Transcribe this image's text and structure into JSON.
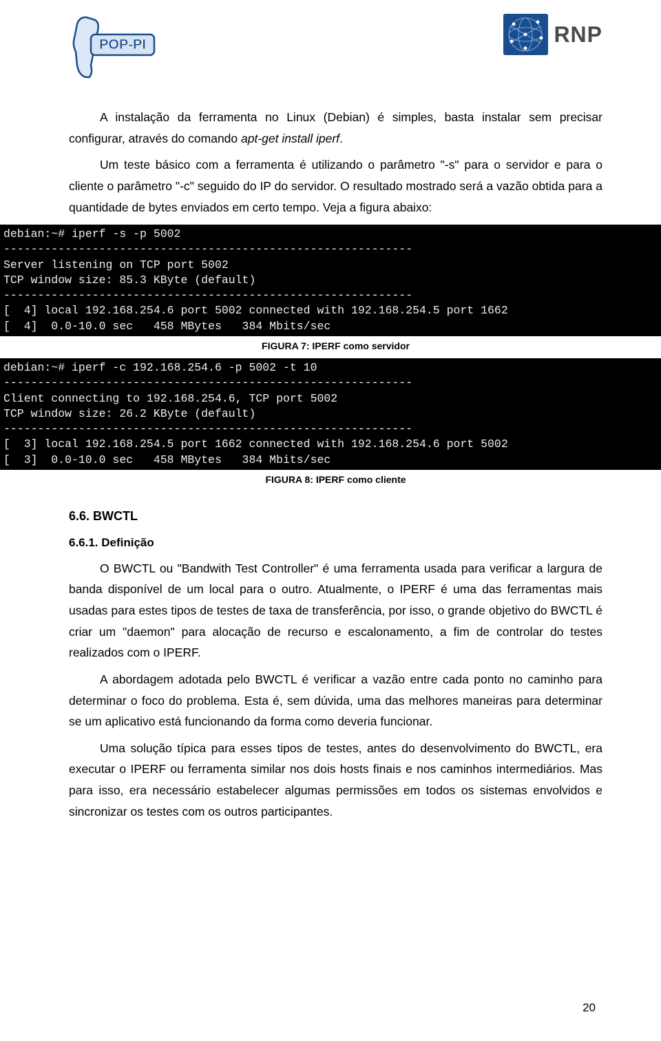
{
  "header": {
    "logo_left_label": "POP-PI",
    "logo_right_label": "RNP"
  },
  "para1_a": "A instalação da ferramenta no Linux (Debian) é simples, basta instalar sem precisar configurar, através do comando ",
  "para1_b": "apt-get install iperf",
  "para1_c": ".",
  "para2_a": "Um teste básico com a ferramenta é utilizando o parâmetro \"-s\" para o servidor e para o cliente o parâmetro \"-c\" seguido do IP do servidor. O resultado mostrado será a vazão obtida para a quantidade de bytes enviados em certo tempo. Veja a figura abaixo:",
  "terminal1": "debian:~# iperf -s -p 5002\n------------------------------------------------------------\nServer listening on TCP port 5002\nTCP window size: 85.3 KByte (default)\n------------------------------------------------------------\n[  4] local 192.168.254.6 port 5002 connected with 192.168.254.5 port 1662\n[  4]  0.0-10.0 sec   458 MBytes   384 Mbits/sec",
  "fig7_bold": "FIGURA 7: ",
  "fig7_text": "IPERF como servidor",
  "terminal2": "debian:~# iperf -c 192.168.254.6 -p 5002 -t 10\n------------------------------------------------------------\nClient connecting to 192.168.254.6, TCP port 5002\nTCP window size: 26.2 KByte (default)\n------------------------------------------------------------\n[  3] local 192.168.254.5 port 1662 connected with 192.168.254.6 port 5002\n[  3]  0.0-10.0 sec   458 MBytes   384 Mbits/sec",
  "fig8_bold": "FIGURA 8: ",
  "fig8_text": "IPERF como cliente",
  "h2_bwctl": "6.6. BWCTL",
  "h3_def": "6.6.1. Definição",
  "para3": "O BWCTL ou \"Bandwith Test Controller\" é uma ferramenta usada para verificar a largura de banda disponível de um local para o outro. Atualmente, o IPERF é uma das ferramentas mais usadas para estes tipos de testes de taxa de transferência, por isso, o grande objetivo do BWCTL é criar um \"daemon\" para alocação de recurso e escalonamento, a fim de controlar do testes realizados com o IPERF.",
  "para4": "A abordagem adotada pelo BWCTL é verificar a vazão entre cada ponto no caminho para determinar o foco do problema. Esta é, sem dúvida, uma das melhores maneiras para determinar se um aplicativo está funcionando da forma como deveria funcionar.",
  "para5": "Uma solução típica para esses tipos de testes, antes do desenvolvimento do BWCTL, era executar o IPERF ou ferramenta similar nos dois hosts finais e nos caminhos intermediários. Mas para isso, era necessário estabelecer algumas permissões em todos os sistemas envolvidos e sincronizar os testes com os outros participantes.",
  "page_number": "20"
}
